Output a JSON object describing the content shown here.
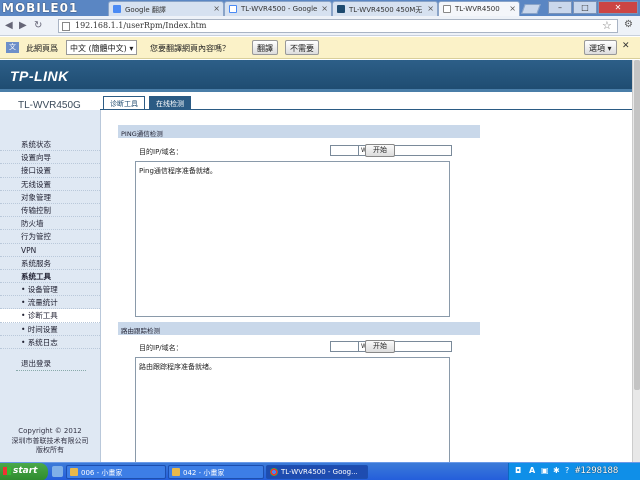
{
  "watermark_logo": "MOBILE01",
  "browser": {
    "tabs": [
      {
        "label": "Google 翻譯",
        "icon": "google-translate-icon"
      },
      {
        "label": "TL-WVR4500 - Google",
        "icon": "google-icon"
      },
      {
        "label": "TL-WVR4500 450M无",
        "icon": "tplink-icon"
      },
      {
        "label": "TL-WVR4500",
        "icon": "page-icon",
        "active": true
      }
    ],
    "url": "192.168.1.1/userRpm/Index.htm"
  },
  "translate_bar": {
    "prefix": "此網頁爲",
    "language": "中文 (簡體中文)",
    "question": "您要翻譯網頁內容嗎？",
    "translate_label": "翻譯",
    "decline_label": "不需要",
    "options_label": "選項"
  },
  "router": {
    "brand": "TP-LINK",
    "model": "TL-WVR450G",
    "tabs": [
      "诊断工具",
      "在线检测"
    ],
    "menu": [
      {
        "label": "系统状态"
      },
      {
        "label": "设置向导"
      },
      {
        "label": "接口设置"
      },
      {
        "label": "无线设置"
      },
      {
        "label": "对象管理"
      },
      {
        "label": "传输控制"
      },
      {
        "label": "防火墙"
      },
      {
        "label": "行为管控"
      },
      {
        "label": "VPN"
      },
      {
        "label": "系统服务"
      },
      {
        "label": "系统工具",
        "bold": true
      },
      {
        "label": "• 设备管理"
      },
      {
        "label": "• 流量统计"
      },
      {
        "label": "• 诊断工具",
        "active": true
      },
      {
        "label": "• 时间设置"
      },
      {
        "label": "• 系统日志"
      }
    ],
    "logout": "退出登录",
    "copyright": [
      "Copyright © 2012",
      "深圳市普联技术有限公司",
      "版权所有"
    ],
    "ping": {
      "title": "PING通信检测",
      "target_label": "目的IP/域名：",
      "wan": "WAN1",
      "start": "开始",
      "result": "Ping通信程序准备就绪。"
    },
    "trace": {
      "title": "路由跟踪检测",
      "target_label": "目的IP/域名：",
      "wan": "WAN1",
      "start": "开始",
      "result": "路由跟踪程序准备就绪。"
    }
  },
  "taskbar": {
    "start": "start",
    "tasks": [
      {
        "label": "006 - 小畫家"
      },
      {
        "label": "042 - 小畫家"
      },
      {
        "label": "TL-WVR4500 - Goog...",
        "active": true
      }
    ],
    "tray_lang": "A",
    "watermark_id": "#1298188"
  }
}
